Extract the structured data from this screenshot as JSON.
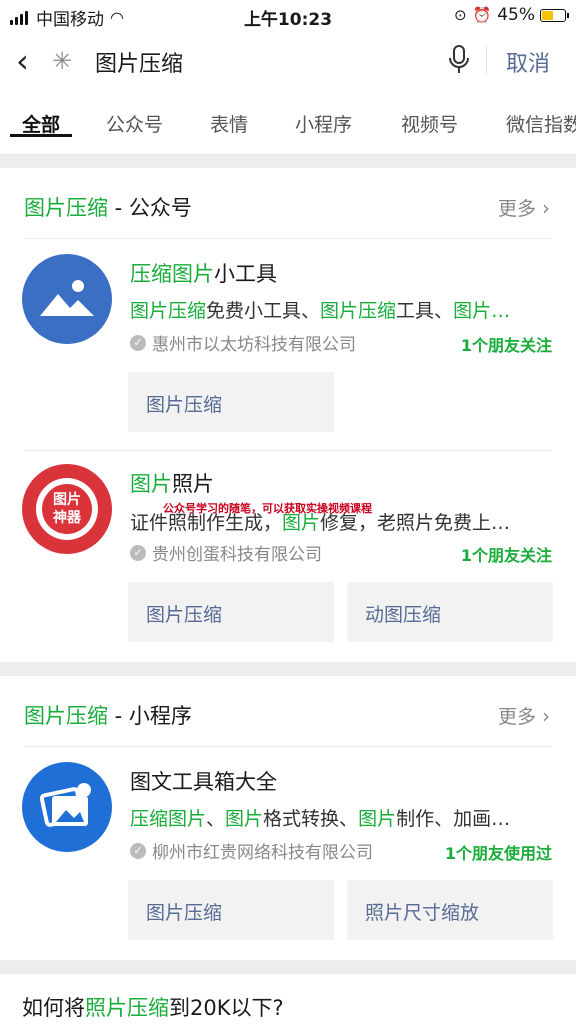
{
  "status": {
    "carrier": "中国移动",
    "time": "上午10:23",
    "battery": "45%"
  },
  "search": {
    "query": "图片压缩",
    "cancel": "取消"
  },
  "tabs": [
    "全部",
    "公众号",
    "表情",
    "小程序",
    "视频号",
    "微信指数"
  ],
  "section_accounts": {
    "title_hl": "图片压缩",
    "title_rest": " - 公众号",
    "more": "更多",
    "items": [
      {
        "name_hl": "压缩图片",
        "name_rest": "小工具",
        "desc": [
          "图片压缩",
          "免费小工具、",
          "图片压缩",
          "工具、",
          "图片…"
        ],
        "org": "惠州市以太坊科技有限公司",
        "friends": "1个朋友关注",
        "chips": [
          "图片压缩"
        ]
      },
      {
        "name_hl": "图片",
        "name_rest": "照片",
        "desc_pre": "证件照制作生成，",
        "desc_hl": "图片",
        "desc_post": "修复，老照片免费上…",
        "org": "贵州创蛋科技有限公司",
        "friends": "1个朋友关注",
        "chips": [
          "图片压缩",
          "动图压缩"
        ],
        "avatar_text": [
          "图片",
          "神器"
        ]
      }
    ]
  },
  "overlay_caption": "公众号学习的随笔，可以获取实操视频课程",
  "section_mini": {
    "title_hl": "图片压缩",
    "title_rest": " - 小程序",
    "more": "更多",
    "item": {
      "name": "图文工具箱大全",
      "desc": [
        "压缩图片",
        "、",
        "图片",
        "格式转换、",
        "图片",
        "制作、加画…"
      ],
      "org": "柳州市红贵网络科技有限公司",
      "friends": "1个朋友使用过",
      "chips": [
        "图片压缩",
        "照片尺寸缩放"
      ]
    }
  },
  "question": {
    "pre": "如何将",
    "hl": "照片压缩",
    "post": "到20K以下?"
  },
  "colors": {
    "accent": "#1aad3b",
    "link": "#576b95",
    "avatar_blue": "#3b6fc4",
    "avatar_red": "#d9343a",
    "mini_blue": "#1f6fd6"
  }
}
